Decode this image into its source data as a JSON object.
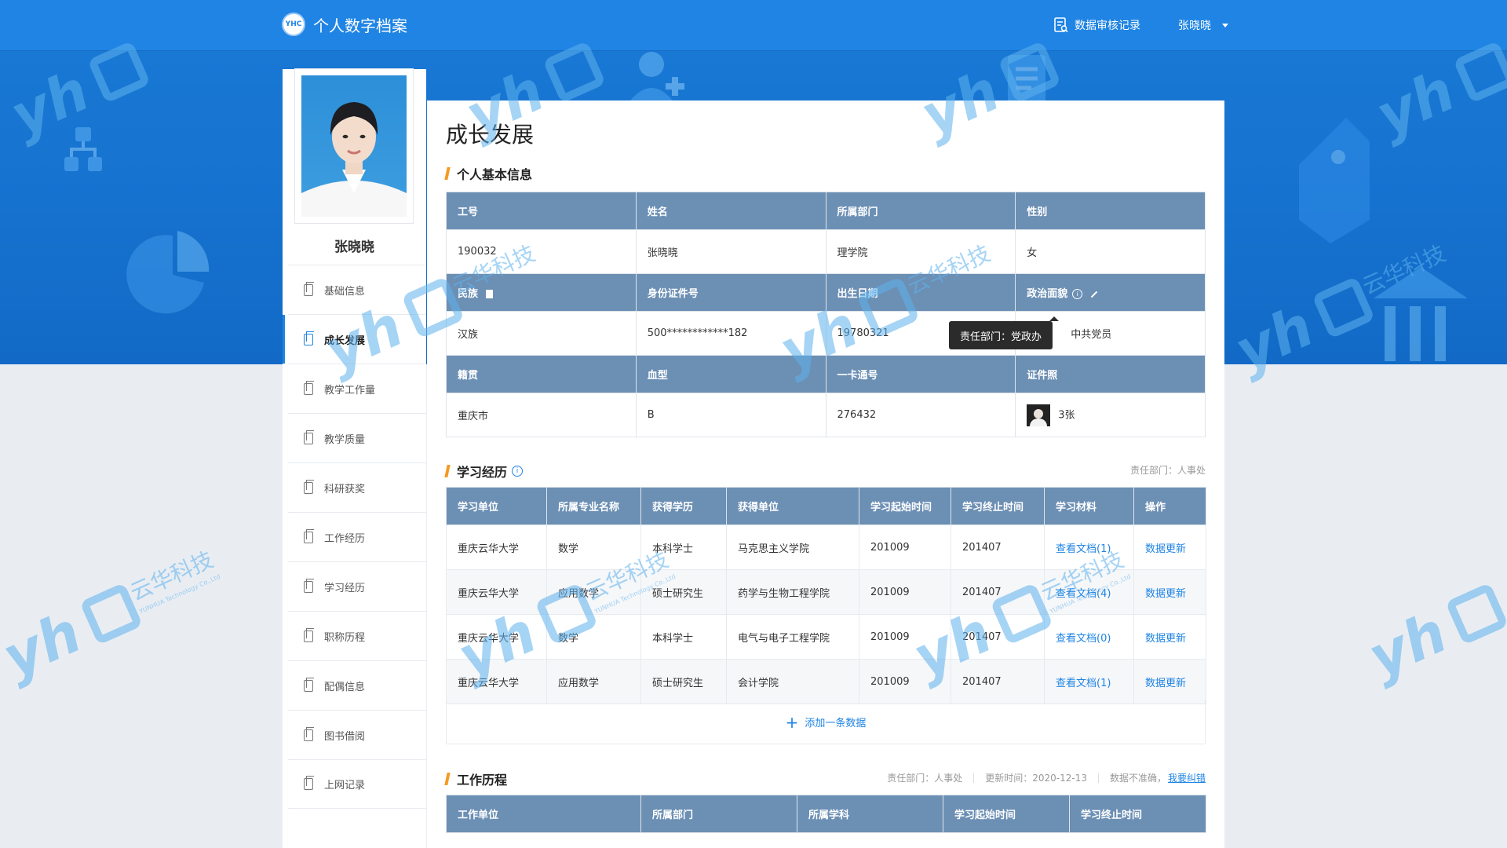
{
  "app": {
    "title": "个人数字档案",
    "logo_badge": "YHC"
  },
  "header": {
    "audit_label": "数据审核记录",
    "user_name": "张晓晓"
  },
  "sidebar": {
    "profile_name": "张晓晓",
    "items": [
      {
        "label": "基础信息",
        "active": false
      },
      {
        "label": "成长发展",
        "active": true
      },
      {
        "label": "教学工作量",
        "active": false
      },
      {
        "label": "教学质量",
        "active": false
      },
      {
        "label": "科研获奖",
        "active": false
      },
      {
        "label": "工作经历",
        "active": false
      },
      {
        "label": "学习经历",
        "active": false
      },
      {
        "label": "职称历程",
        "active": false
      },
      {
        "label": "配偶信息",
        "active": false
      },
      {
        "label": "图书借阅",
        "active": false
      },
      {
        "label": "上网记录",
        "active": false
      }
    ]
  },
  "main": {
    "page_title": "成长发展",
    "basic": {
      "section_title": "个人基本信息",
      "rows": [
        {
          "headers": [
            "工号",
            "姓名",
            "所属部门",
            "性别"
          ],
          "values": [
            "190032",
            "张晓晓",
            "理学院",
            "女"
          ]
        },
        {
          "headers": [
            "民族",
            "身份证件号",
            "出生日期",
            "政治面貌"
          ],
          "values": [
            "汉族",
            "500************182",
            "19780321",
            "中共党员"
          ]
        },
        {
          "headers": [
            "籍贯",
            "血型",
            "一卡通号",
            "证件照"
          ],
          "values": [
            "重庆市",
            "B",
            "276432",
            "3张"
          ]
        }
      ],
      "tooltip": "责任部门：党政办"
    },
    "study": {
      "section_title": "学习经历",
      "meta": "责任部门：人事处",
      "columns": [
        "学习单位",
        "所属专业名称",
        "获得学历",
        "获得单位",
        "学习起始时间",
        "学习终止时间",
        "学习材料",
        "操作"
      ],
      "rows": [
        [
          "重庆云华大学",
          "数学",
          "本科学士",
          "马克思主义学院",
          "201009",
          "201407",
          "查看文档(1)",
          "数据更新"
        ],
        [
          "重庆云华大学",
          "应用数学",
          "硕士研究生",
          "药学与生物工程学院",
          "201009",
          "201407",
          "查看文档(4)",
          "数据更新"
        ],
        [
          "重庆云华大学",
          "数学",
          "本科学士",
          "电气与电子工程学院",
          "201009",
          "201407",
          "查看文档(0)",
          "数据更新"
        ],
        [
          "重庆云华大学",
          "应用数学",
          "硕士研究生",
          "会计学院",
          "201009",
          "201407",
          "查看文档(1)",
          "数据更新"
        ]
      ],
      "add_label": "添加一条数据"
    },
    "work": {
      "section_title": "工作历程",
      "meta_dept": "责任部门：人事处",
      "meta_updated": "更新时间：2020-12-13",
      "meta_inaccurate": "数据不准确，",
      "meta_link": "我要纠错",
      "columns": [
        "工作单位",
        "所属部门",
        "所属学科",
        "学习起始时间",
        "学习终止时间"
      ]
    }
  },
  "watermark": {
    "brand": "云华科技",
    "sub": "YUNHUA Technology Co.,Ltd"
  },
  "colors": {
    "header": "#1f84e4",
    "table_header": "#6c8fb4",
    "accent": "#f59a23",
    "link": "#1f84e4"
  }
}
